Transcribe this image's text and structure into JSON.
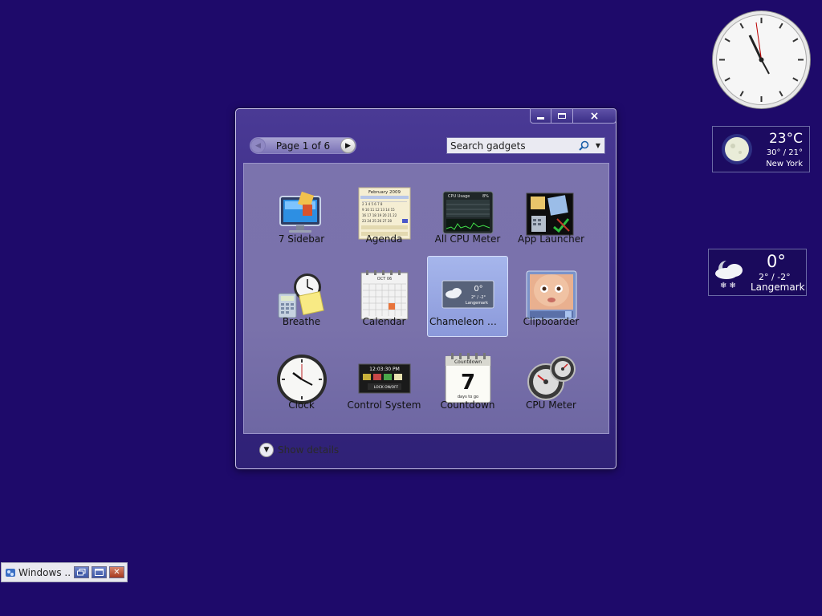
{
  "gallery": {
    "pager_label": "Page 1 of 6",
    "search_placeholder": "Search gadgets",
    "show_details": "Show details",
    "close_glyph": "×",
    "gadgets": [
      {
        "name": "7 Sidebar",
        "icon": "monitor-icon"
      },
      {
        "name": "Agenda",
        "icon": "agenda-calendar-icon"
      },
      {
        "name": "All CPU Meter",
        "icon": "cpu-monitor-icon"
      },
      {
        "name": "App Launcher",
        "icon": "app-launcher-icon"
      },
      {
        "name": "Breathe",
        "icon": "clock-calculator-icon"
      },
      {
        "name": "Calendar",
        "icon": "calendar-icon"
      },
      {
        "name": "Chameleon We...",
        "icon": "weather-icon",
        "selected": true
      },
      {
        "name": "Clipboarder",
        "icon": "baby-face-icon"
      },
      {
        "name": "Clock",
        "icon": "clock-icon"
      },
      {
        "name": "Control System",
        "icon": "control-panel-icon"
      },
      {
        "name": "Countdown",
        "icon": "countdown-calendar-icon"
      },
      {
        "name": "CPU Meter",
        "icon": "cpu-gauge-icon"
      }
    ],
    "icon_text": {
      "agenda_month": "February 2009",
      "cpu_title": "CPU Usage",
      "cpu_pct": "8%",
      "calendar_month": "OCT 06",
      "weather_temp": "0°",
      "weather_range": "2° / -2°",
      "weather_city": "Langemark",
      "control_time": "12:03:30 PM",
      "control_lock": "LOCK ON/OFF",
      "countdown_title": "Countdown",
      "countdown_num": "7",
      "countdown_sub": "days to go"
    }
  },
  "weather_new_york": {
    "temp": "23°C",
    "range": "30° / 21°",
    "city": "New York"
  },
  "weather_langemark": {
    "temp": "0°",
    "range": "2° / -2°",
    "city": "Langemark"
  },
  "taskbar": {
    "label": "Windows ...",
    "close_glyph": "✕"
  },
  "colors": {
    "desktop": "#1e0a6a",
    "window": "#3b2c86",
    "content": "#7a72ab",
    "selected_tile": "#a6b6ec"
  }
}
